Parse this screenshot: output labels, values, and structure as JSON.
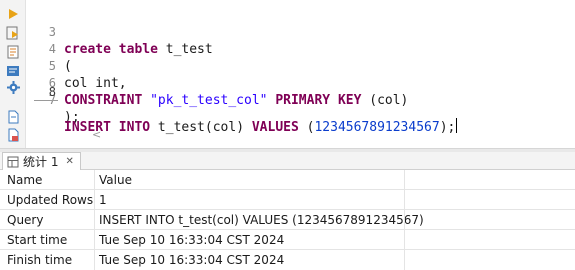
{
  "toolbar": {
    "icons": [
      "run-icon",
      "execute-script-icon",
      "explain-plan-icon",
      "format-icon",
      "terminal-icon",
      "settings-icon",
      "new-script-icon",
      "export-icon"
    ]
  },
  "editor": {
    "lines": [
      {
        "num": "3",
        "tokens": [
          {
            "t": "create table ",
            "c": "kw"
          },
          {
            "t": "t_test",
            "c": "plain"
          }
        ]
      },
      {
        "num": "4",
        "tokens": [
          {
            "t": "(",
            "c": "plain"
          }
        ]
      },
      {
        "num": "5",
        "tokens": [
          {
            "t": "col int,",
            "c": "plain"
          }
        ]
      },
      {
        "num": "6",
        "tokens": [
          {
            "t": "CONSTRAINT ",
            "c": "kw"
          },
          {
            "t": "\"pk_t_test_col\"",
            "c": "str"
          },
          {
            "t": " PRIMARY KEY ",
            "c": "kw"
          },
          {
            "t": "(col)",
            "c": "plain"
          }
        ]
      },
      {
        "num": "7",
        "tokens": [
          {
            "t": ");",
            "c": "plain"
          }
        ]
      },
      {
        "num": "7",
        "tokens": [
          {
            "t": "INSERT INTO ",
            "c": "kw"
          },
          {
            "t": "t_test(col) ",
            "c": "plain"
          },
          {
            "t": "VALUES ",
            "c": "kw"
          },
          {
            "t": "(",
            "c": "plain"
          },
          {
            "t": "1234567891234567",
            "c": "num"
          },
          {
            "t": ");",
            "c": "plain"
          }
        ]
      }
    ],
    "gutter_numbers": [
      "3",
      "4",
      "5",
      "6",
      "7",
      "8"
    ]
  },
  "results": {
    "tab_label": "统计 1",
    "tab_close": "✕",
    "columns": [
      "Name",
      "Value"
    ],
    "rows": [
      {
        "name": "Updated Rows",
        "value": "1"
      },
      {
        "name": "Query",
        "value": "INSERT INTO t_test(col) VALUES (1234567891234567)"
      },
      {
        "name": "Start time",
        "value": "Tue Sep 10 16:33:04 CST 2024"
      },
      {
        "name": "Finish time",
        "value": "Tue Sep 10 16:33:04 CST 2024"
      }
    ]
  }
}
